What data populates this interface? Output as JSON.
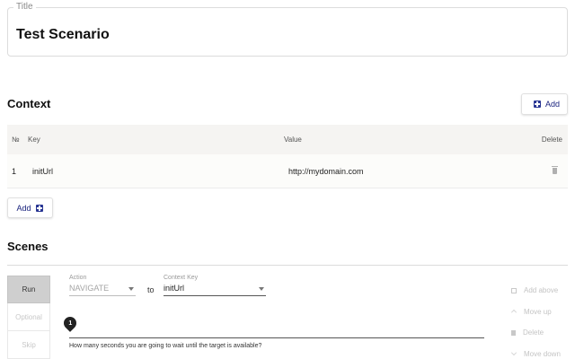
{
  "title_field": {
    "legend": "Title",
    "value": "Test Scenario"
  },
  "context": {
    "heading": "Context",
    "add_label": "Add",
    "columns": {
      "no": "№",
      "key": "Key",
      "value": "Value",
      "delete": "Delete"
    },
    "rows": [
      {
        "no": "1",
        "key": "initUrl",
        "value": "http://mydomain.com"
      }
    ],
    "add_bottom_label": "Add"
  },
  "scenes": {
    "heading": "Scenes",
    "side_buttons": {
      "run": "Run",
      "optional": "Optional",
      "skip": "Skip"
    },
    "action_label": "Action",
    "action_value": "NAVIGATE",
    "to_text": "to",
    "context_key_label": "Context Key",
    "context_key_value": "initUrl",
    "marker_value": "1",
    "helper_text": "How many seconds you are going to wait until the target is available?",
    "right_actions": {
      "add_above": "Add above",
      "move_up": "Move up",
      "delete": "Delete",
      "move_down": "Move down"
    }
  },
  "colors": {
    "accent": "#1a237e",
    "header_bg": "#f5f4f2",
    "run_bg": "#cfcfcf"
  }
}
